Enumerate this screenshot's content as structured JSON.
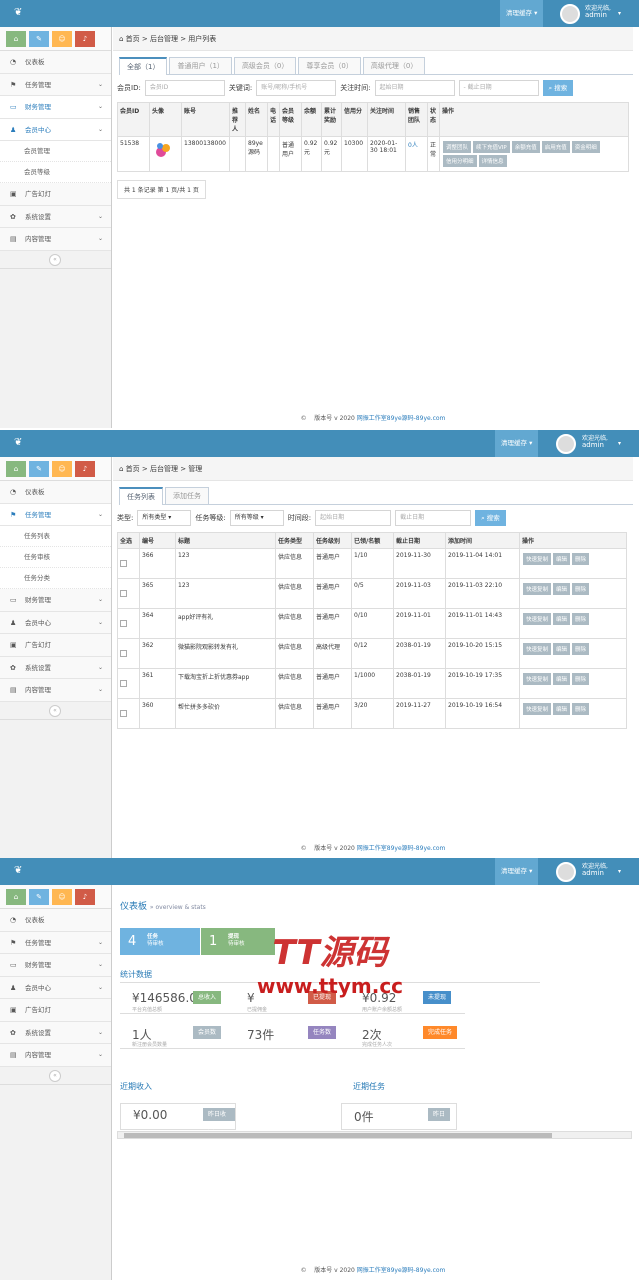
{
  "app": {
    "cache_btn": "清理缓存",
    "welcome": "欢迎光临,",
    "user": "admin",
    "brand_color": "#438eb9"
  },
  "sidebar": {
    "items": [
      {
        "label": "仪表板",
        "icon": "dashboard-icon"
      },
      {
        "label": "任务管理",
        "icon": "flag-icon"
      },
      {
        "label": "财务管理",
        "icon": "wallet-icon"
      },
      {
        "label": "会员中心",
        "icon": "user-icon"
      },
      {
        "label": "广告幻灯",
        "icon": "picture-icon"
      },
      {
        "label": "系统设置",
        "icon": "gear-icon"
      },
      {
        "label": "内容管理",
        "icon": "book-icon"
      }
    ],
    "member_subs": [
      "会员管理",
      "会员等级"
    ],
    "task_subs": [
      "任务列表",
      "任务审核",
      "任务分类"
    ],
    "shortcut_colors": [
      "#87b87f",
      "#6fb3e0",
      "#ffb752",
      "#d15b47"
    ]
  },
  "s1": {
    "breadcrumb": "首页 > 后台管理 > 用户列表",
    "tabs": [
      "全部（1）",
      "普通用户（1）",
      "高级会员（0）",
      "尊享会员（0）",
      "高级代理（0）"
    ],
    "filters": {
      "id_label": "会员ID:",
      "id_ph": "会员ID",
      "kw_label": "关键词:",
      "kw_ph": "账号/昵称/手机号",
      "time_label": "关注时间:",
      "start_ph": "起始日期",
      "end_ph": "- 截止日期",
      "search": "搜索"
    },
    "headers": [
      "会员ID",
      "头像",
      "账号",
      "推荐人",
      "姓名",
      "电话",
      "会员等级",
      "余额",
      "累计奖励",
      "信用分",
      "关注时间",
      "销售团队",
      "状态",
      "操作"
    ],
    "row": {
      "id": "51538",
      "account": "13800138000",
      "ref": "",
      "name": "89ye源码",
      "phone": "",
      "level": "普通用户",
      "balance": "0.92元",
      "reward": "0.92元",
      "credit": "10300",
      "time": "2020-01-30 18:01",
      "team": "0人",
      "status": "正常"
    },
    "ops": [
      "调整团队",
      "续下充值VIP",
      "余额充值",
      "启用充值",
      "资金明细",
      "信用分明细",
      "详情信息"
    ],
    "pagination": "共 1 条记录 第 1 页/共 1 页"
  },
  "s2": {
    "breadcrumb": "首页 > 后台管理 > 管理",
    "tabs": [
      "任务列表",
      "添加任务"
    ],
    "filters": {
      "type_label": "类型:",
      "type_val": "所有类型",
      "level_label": "任务等级:",
      "level_val": "所有等级",
      "time_label": "时间段:",
      "start_ph": "起始日期",
      "end_ph": "截止日期",
      "search": "搜索"
    },
    "headers": [
      "全选",
      "编号",
      "标题",
      "任务类型",
      "任务级别",
      "已领/名额",
      "截止日期",
      "添加时间",
      "操作"
    ],
    "rows": [
      {
        "id": "366",
        "title": "123",
        "type": "供应信息",
        "level": "普通用户",
        "quota": "1/10",
        "end": "2019-11-30",
        "add": "2019-11-04 14:01"
      },
      {
        "id": "365",
        "title": "123",
        "type": "供应信息",
        "level": "普通用户",
        "quota": "0/5",
        "end": "2019-11-03",
        "add": "2019-11-03 22:10"
      },
      {
        "id": "364",
        "title": "app好评有礼",
        "type": "供应信息",
        "level": "普通用户",
        "quota": "0/10",
        "end": "2019-11-01",
        "add": "2019-11-01 14:43"
      },
      {
        "id": "362",
        "title": "微猫影院观影转发有礼",
        "type": "供应信息",
        "level": "高级代理",
        "quota": "0/12",
        "end": "2038-01-19",
        "add": "2019-10-20 15:15"
      },
      {
        "id": "361",
        "title": "下载淘宝折上折优惠券app",
        "type": "供应信息",
        "level": "普通用户",
        "quota": "1/1000",
        "end": "2038-01-19",
        "add": "2019-10-19 17:35"
      },
      {
        "id": "360",
        "title": "帮忙拼多多砍价",
        "type": "供应信息",
        "level": "普通用户",
        "quota": "3/20",
        "end": "2019-11-27",
        "add": "2019-10-19 16:54"
      }
    ],
    "ops": [
      "快速复制",
      "编辑",
      "删除"
    ]
  },
  "s3": {
    "title": "仪表板",
    "subtitle": "» overview & stats",
    "kpi": [
      {
        "num": "4",
        "t1": "任务",
        "t2": "待审核",
        "color": "#6fb3e0"
      },
      {
        "num": "1",
        "t1": "提现",
        "t2": "待审核",
        "color": "#87b87f"
      }
    ],
    "stats_title": "统计数据",
    "stats": [
      {
        "v": "¥146586.0",
        "d": "平台充值总额",
        "lab": "总收入",
        "c": "#87b87f"
      },
      {
        "v": "¥",
        "d": "已提佣金",
        "lab": "已提现",
        "c": "#d15b47"
      },
      {
        "v": "¥0.92",
        "d": "用户账户余额总额",
        "lab": "未提现",
        "c": "#478fca"
      },
      {
        "v": "1人",
        "d": "新注册会员数量",
        "lab": "会员数",
        "c": "#abbac3"
      },
      {
        "v": "73件",
        "d": "",
        "lab": "任务数",
        "c": "#9585bf"
      },
      {
        "v": "2次",
        "d": "完成任务人次",
        "lab": "完成任务",
        "c": "#ff892a"
      }
    ],
    "recent_income": "近期收入",
    "recent_task": "近期任务",
    "income_today": "¥0.00",
    "income_lab": "昨日收入",
    "task_today": "0件",
    "task_lab": "昨日",
    "watermark1": "TT源码",
    "watermark2": "www.ttym.cc"
  },
  "footer": {
    "copy": "©",
    "version": "版本号 v 2020",
    "link": "网振工作室89ye源码-89ye.com"
  }
}
